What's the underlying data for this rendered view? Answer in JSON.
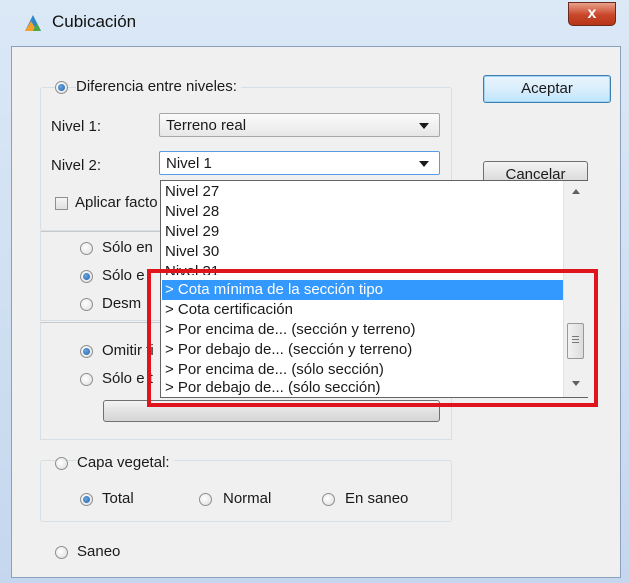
{
  "window": {
    "title": "Cubicación",
    "close_label": "x"
  },
  "buttons": {
    "ok": "Aceptar",
    "cancel": "Cancelar"
  },
  "levels": {
    "radio_label": "Diferencia entre niveles:",
    "nivel1_label": "Nivel 1:",
    "nivel1_value": "Terreno real",
    "nivel2_label": "Nivel 2:",
    "nivel2_value": "Nivel 1",
    "factor_label": "Aplicar facto"
  },
  "options": {
    "solo_en": "Sólo en",
    "solo_e": "Sólo e",
    "desm": "Desm",
    "omitir": "Omitir ti",
    "solo_e2": "Sólo e t"
  },
  "dropdown": {
    "items": [
      "Nivel 27",
      "Nivel 28",
      "Nivel 29",
      "Nivel 30",
      "Nivel 31",
      "> Cota mínima de la sección tipo",
      "> Cota certificación",
      "> Por encima de... (sección y terreno)",
      "> Por debajo de... (sección y terreno)",
      "> Por encima de... (sólo sección)",
      "> Por debajo de... (sólo sección)"
    ],
    "selected_index": 5
  },
  "vegetal": {
    "label": "Capa vegetal:",
    "total": "Total",
    "normal": "Normal",
    "saneo_inner": "En saneo"
  },
  "saneo": {
    "label": "Saneo"
  },
  "colors": {
    "highlight_box": "#e0141d",
    "selection": "#3399ff"
  }
}
